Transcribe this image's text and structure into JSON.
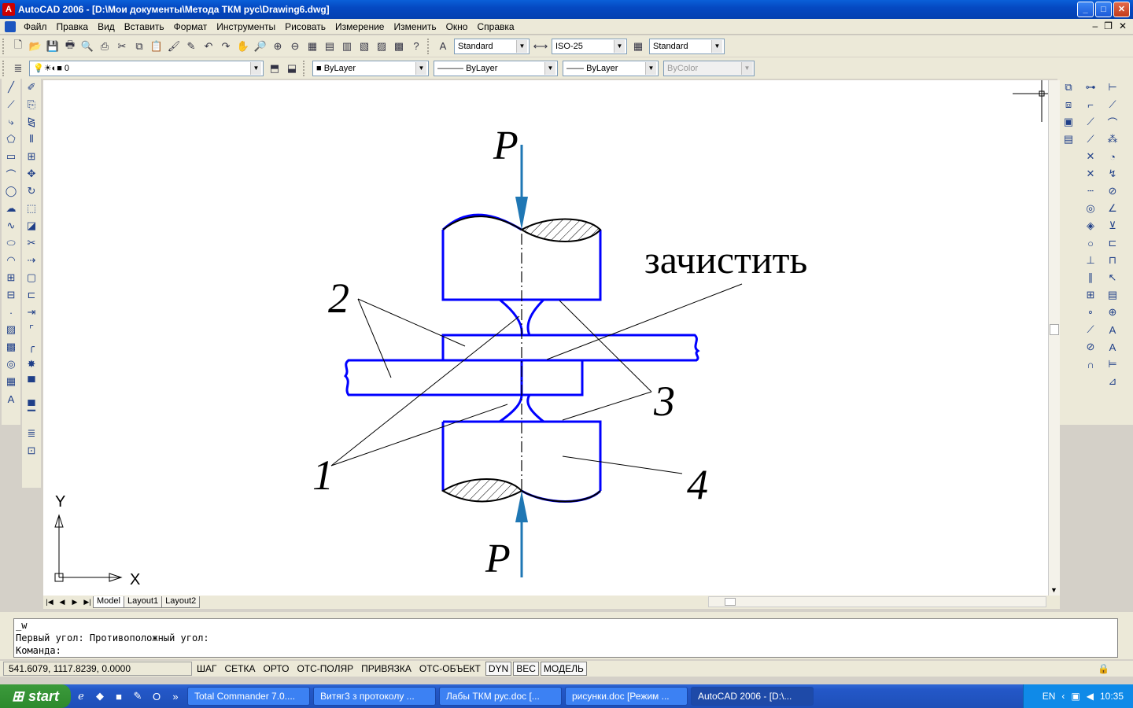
{
  "window": {
    "title": "AutoCAD 2006 - [D:\\Мои документы\\Метода ТКМ рус\\Drawing6.dwg]"
  },
  "menu": [
    "Файл",
    "Правка",
    "Вид",
    "Вставить",
    "Формат",
    "Инструменты",
    "Рисовать",
    "Измерение",
    "Изменить",
    "Окно",
    "Справка"
  ],
  "styles": {
    "text_style": "Standard",
    "dim_style": "ISO-25",
    "table_style": "Standard"
  },
  "layer": {
    "current": "0"
  },
  "properties": {
    "color": "ByLayer",
    "linetype": "ByLayer",
    "lineweight": "ByLayer",
    "plotstyle": "ByColor"
  },
  "drawing": {
    "labels": {
      "force_top": "P",
      "force_bottom": "P",
      "label_1": "1",
      "label_2": "2",
      "label_3": "3",
      "label_4": "4",
      "note": "зачистить"
    },
    "ucs": {
      "x": "X",
      "y": "Y"
    }
  },
  "layout_tabs": [
    "Model",
    "Layout1",
    "Layout2"
  ],
  "command": {
    "line1": "_w",
    "line2": "Первый угол: Противоположный угол:",
    "line3": "Команда:"
  },
  "status": {
    "coords": "541.6079, 1117.8239, 0.0000",
    "buttons": [
      "ШАГ",
      "СЕТКА",
      "ОРТО",
      "ОТС-ПОЛЯР",
      "ПРИВЯЗКА",
      "ОТС-ОБЪЕКТ",
      "DYN",
      "ВЕС",
      "МОДЕЛЬ"
    ]
  },
  "taskbar": {
    "start": "start",
    "tasks": [
      "Total Commander 7.0....",
      "Витяг3 з протоколу ...",
      "Лабы ТКМ рус.doc [...",
      "рисунки.doc [Режим ...",
      "AutoCAD 2006 - [D:\\..."
    ],
    "lang": "EN",
    "clock": "10:35"
  },
  "colors": {
    "part_stroke": "#0000ff",
    "arrow": "#1f77b4"
  }
}
